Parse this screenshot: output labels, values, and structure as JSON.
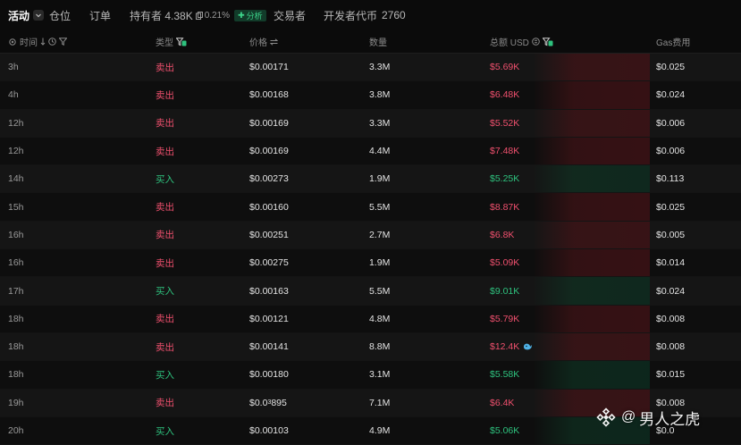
{
  "tabs": [
    {
      "label": "活动",
      "active": true
    },
    {
      "label": "仓位"
    },
    {
      "label": "订单"
    },
    {
      "label": "持有者 4.38K",
      "percent": "0.21%",
      "badge": "分析"
    },
    {
      "label": "交易者"
    },
    {
      "label": "开发者代币",
      "count": "2760"
    }
  ],
  "columns": {
    "time": "时间",
    "type": "类型",
    "price": "价格",
    "qty": "数量",
    "total": "总额 USD",
    "gas": "Gas费用"
  },
  "rows": [
    {
      "time": "3h",
      "type": "卖出",
      "side": "sell",
      "price": "$0.00171",
      "qty": "3.3M",
      "total": "$5.69K",
      "gas": "$0.025"
    },
    {
      "time": "4h",
      "type": "卖出",
      "side": "sell",
      "price": "$0.00168",
      "qty": "3.8M",
      "total": "$6.48K",
      "gas": "$0.024"
    },
    {
      "time": "12h",
      "type": "卖出",
      "side": "sell",
      "price": "$0.00169",
      "qty": "3.3M",
      "total": "$5.52K",
      "gas": "$0.006"
    },
    {
      "time": "12h",
      "type": "卖出",
      "side": "sell",
      "price": "$0.00169",
      "qty": "4.4M",
      "total": "$7.48K",
      "gas": "$0.006"
    },
    {
      "time": "14h",
      "type": "买入",
      "side": "buy",
      "price": "$0.00273",
      "qty": "1.9M",
      "total": "$5.25K",
      "gas": "$0.113"
    },
    {
      "time": "15h",
      "type": "卖出",
      "side": "sell",
      "price": "$0.00160",
      "qty": "5.5M",
      "total": "$8.87K",
      "gas": "$0.025"
    },
    {
      "time": "16h",
      "type": "卖出",
      "side": "sell",
      "price": "$0.00251",
      "qty": "2.7M",
      "total": "$6.8K",
      "gas": "$0.005"
    },
    {
      "time": "16h",
      "type": "卖出",
      "side": "sell",
      "price": "$0.00275",
      "qty": "1.9M",
      "total": "$5.09K",
      "gas": "$0.014"
    },
    {
      "time": "17h",
      "type": "买入",
      "side": "buy",
      "price": "$0.00163",
      "qty": "5.5M",
      "total": "$9.01K",
      "gas": "$0.024"
    },
    {
      "time": "18h",
      "type": "卖出",
      "side": "sell",
      "price": "$0.00121",
      "qty": "4.8M",
      "total": "$5.79K",
      "gas": "$0.008"
    },
    {
      "time": "18h",
      "type": "卖出",
      "side": "sell",
      "price": "$0.00141",
      "qty": "8.8M",
      "total": "$12.4K",
      "gas": "$0.008",
      "whale": true
    },
    {
      "time": "18h",
      "type": "买入",
      "side": "buy",
      "price": "$0.00180",
      "qty": "3.1M",
      "total": "$5.58K",
      "gas": "$0.015"
    },
    {
      "time": "19h",
      "type": "卖出",
      "side": "sell",
      "price_prefix": "$0.0",
      "price_sub": "3",
      "price_rest": "895",
      "qty": "7.1M",
      "total": "$6.4K",
      "gas": "$0.008"
    },
    {
      "time": "20h",
      "type": "买入",
      "side": "buy",
      "price": "$0.00103",
      "qty": "4.9M",
      "total": "$5.06K",
      "gas": "$0.0"
    }
  ],
  "watermark": {
    "text": "男人之虎",
    "at": "@"
  },
  "colors": {
    "sell": "#f0506e",
    "buy": "#2ec27e",
    "accent_badge": "#3dd68c"
  }
}
